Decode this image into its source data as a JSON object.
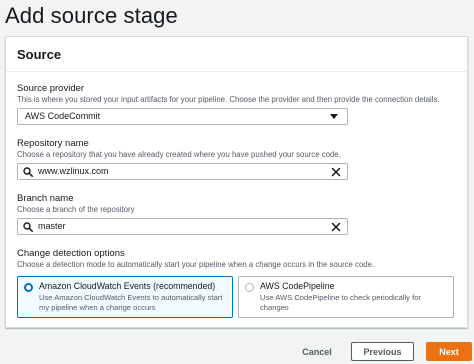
{
  "page": {
    "title": "Add source stage"
  },
  "source_panel": {
    "title": "Source",
    "source_provider": {
      "label": "Source provider",
      "description": "This is where you stored your input artifacts for your pipeline. Choose the provider and then provide the connection details.",
      "selected_value": "AWS CodeCommit"
    },
    "repository_name": {
      "label": "Repository name",
      "description": "Choose a repository that you have already created where you have pushed your source code.",
      "value": "www.wzlinux.com"
    },
    "branch_name": {
      "label": "Branch name",
      "description": "Choose a branch of the repository",
      "value": "master"
    },
    "change_detection": {
      "label": "Change detection options",
      "description": "Choose a detection mode to automatically start your pipeline when a change occurs in the source code.",
      "options": [
        {
          "title": "Amazon CloudWatch Events (recommended)",
          "description": "Use Amazon CloudWatch Events to automatically start my pipeline when a change occurs",
          "selected": true
        },
        {
          "title": "AWS CodePipeline",
          "description": "Use AWS CodePipeline to check periodically for changes",
          "selected": false
        }
      ]
    }
  },
  "footer": {
    "cancel_label": "Cancel",
    "previous_label": "Previous",
    "next_label": "Next"
  },
  "colors": {
    "accent": "#0073bb",
    "primary_button": "#ec7211",
    "background": "#f2f3f3"
  },
  "icons": {
    "dropdown": "caret-down-icon",
    "search": "search-icon",
    "clear": "close-icon",
    "radio": "radio-icon"
  }
}
